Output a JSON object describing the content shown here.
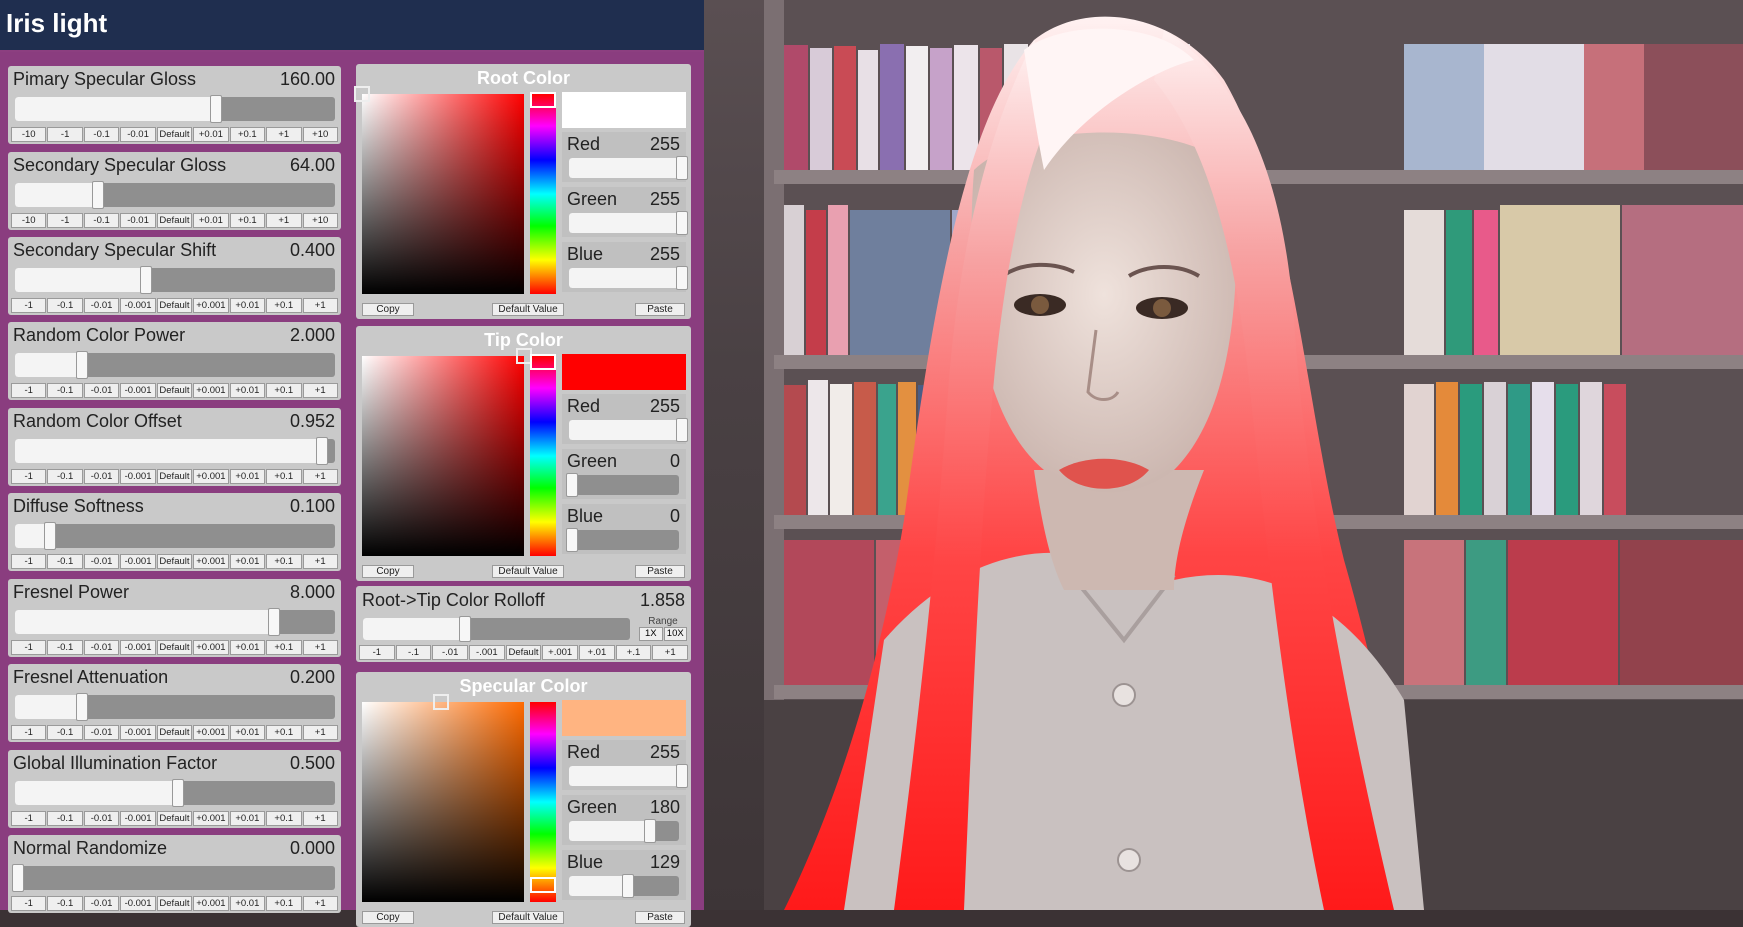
{
  "window": {
    "title": "Iris light"
  },
  "sliders": [
    {
      "label": "Pimary Specular Gloss",
      "value": "160.00",
      "fraction": 0.62,
      "buttons": [
        "-10",
        "-1",
        "-0.1",
        "-0.01",
        "Default",
        "+0.01",
        "+0.1",
        "+1",
        "+10"
      ]
    },
    {
      "label": "Secondary Specular Gloss",
      "value": "64.00",
      "fraction": 0.25,
      "buttons": [
        "-10",
        "-1",
        "-0.1",
        "-0.01",
        "Default",
        "+0.01",
        "+0.1",
        "+1",
        "+10"
      ]
    },
    {
      "label": "Secondary Specular Shift",
      "value": "0.400",
      "fraction": 0.4,
      "buttons": [
        "-1",
        "-0.1",
        "-0.01",
        "-0.001",
        "Default",
        "+0.001",
        "+0.01",
        "+0.1",
        "+1"
      ]
    },
    {
      "label": "Random Color Power",
      "value": "2.000",
      "fraction": 0.2,
      "buttons": [
        "-1",
        "-0.1",
        "-0.01",
        "-0.001",
        "Default",
        "+0.001",
        "+0.01",
        "+0.1",
        "+1"
      ]
    },
    {
      "label": "Random Color Offset",
      "value": "0.952",
      "fraction": 0.95,
      "buttons": [
        "-1",
        "-0.1",
        "-0.01",
        "-0.001",
        "Default",
        "+0.001",
        "+0.01",
        "+0.1",
        "+1"
      ]
    },
    {
      "label": "Diffuse Softness",
      "value": "0.100",
      "fraction": 0.1,
      "buttons": [
        "-1",
        "-0.1",
        "-0.01",
        "-0.001",
        "Default",
        "+0.001",
        "+0.01",
        "+0.1",
        "+1"
      ]
    },
    {
      "label": "Fresnel Power",
      "value": "8.000",
      "fraction": 0.8,
      "buttons": [
        "-1",
        "-0.1",
        "-0.01",
        "-0.001",
        "Default",
        "+0.001",
        "+0.01",
        "+0.1",
        "+1"
      ]
    },
    {
      "label": "Fresnel Attenuation",
      "value": "0.200",
      "fraction": 0.2,
      "buttons": [
        "-1",
        "-0.1",
        "-0.01",
        "-0.001",
        "Default",
        "+0.001",
        "+0.01",
        "+0.1",
        "+1"
      ]
    },
    {
      "label": "Global Illumination Factor",
      "value": "0.500",
      "fraction": 0.5,
      "buttons": [
        "-1",
        "-0.1",
        "-0.01",
        "-0.001",
        "Default",
        "+0.001",
        "+0.01",
        "+0.1",
        "+1"
      ]
    },
    {
      "label": "Normal Randomize",
      "value": "0.000",
      "fraction": 0.0,
      "buttons": [
        "-1",
        "-0.1",
        "-0.01",
        "-0.001",
        "Default",
        "+0.001",
        "+0.01",
        "+0.1",
        "+1"
      ]
    }
  ],
  "pickers": [
    {
      "title": "Root Color",
      "swatch": "#ffffff",
      "hue_color": "#ff0000",
      "sv_pos": [
        0.0,
        0.0
      ],
      "hue_pos": 0.0,
      "channels": [
        {
          "label": "Red",
          "value": "255",
          "fraction": 1.0
        },
        {
          "label": "Green",
          "value": "255",
          "fraction": 1.0
        },
        {
          "label": "Blue",
          "value": "255",
          "fraction": 1.0
        }
      ],
      "copy_label": "Copy",
      "default_label": "Default Value",
      "paste_label": "Paste"
    },
    {
      "title": "Tip Color",
      "swatch": "#ff0000",
      "hue_color": "#ff0000",
      "sv_pos": [
        1.0,
        0.0
      ],
      "hue_pos": 0.0,
      "channels": [
        {
          "label": "Red",
          "value": "255",
          "fraction": 1.0
        },
        {
          "label": "Green",
          "value": "0",
          "fraction": 0.0
        },
        {
          "label": "Blue",
          "value": "0",
          "fraction": 0.0
        }
      ],
      "copy_label": "Copy",
      "default_label": "Default Value",
      "paste_label": "Paste"
    },
    {
      "title": "Specular Color",
      "swatch": "#ffb481",
      "hue_color": "#ff6a00",
      "sv_pos": [
        0.49,
        0.0
      ],
      "hue_pos": 0.95,
      "channels": [
        {
          "label": "Red",
          "value": "255",
          "fraction": 1.0
        },
        {
          "label": "Green",
          "value": "180",
          "fraction": 0.706
        },
        {
          "label": "Blue",
          "value": "129",
          "fraction": 0.506
        }
      ],
      "copy_label": "Copy",
      "default_label": "Default Value",
      "paste_label": "Paste"
    }
  ],
  "rolloff": {
    "label": "Root->Tip Color Rolloff",
    "value": "1.858",
    "fraction": 0.37,
    "range_label": "Range",
    "range_buttons": [
      "1X",
      "10X"
    ],
    "buttons": [
      "-1",
      "-.1",
      "-.01",
      "-.001",
      "Default",
      "+.001",
      "+.01",
      "+.1",
      "+1"
    ]
  },
  "colors": {
    "title_bg": "#1f2e4f",
    "panel_bg": "#8a3d7f",
    "block_bg": "#c9c9c9",
    "hair_root": "#ffd9dc",
    "hair_tip": "#ff2020"
  }
}
